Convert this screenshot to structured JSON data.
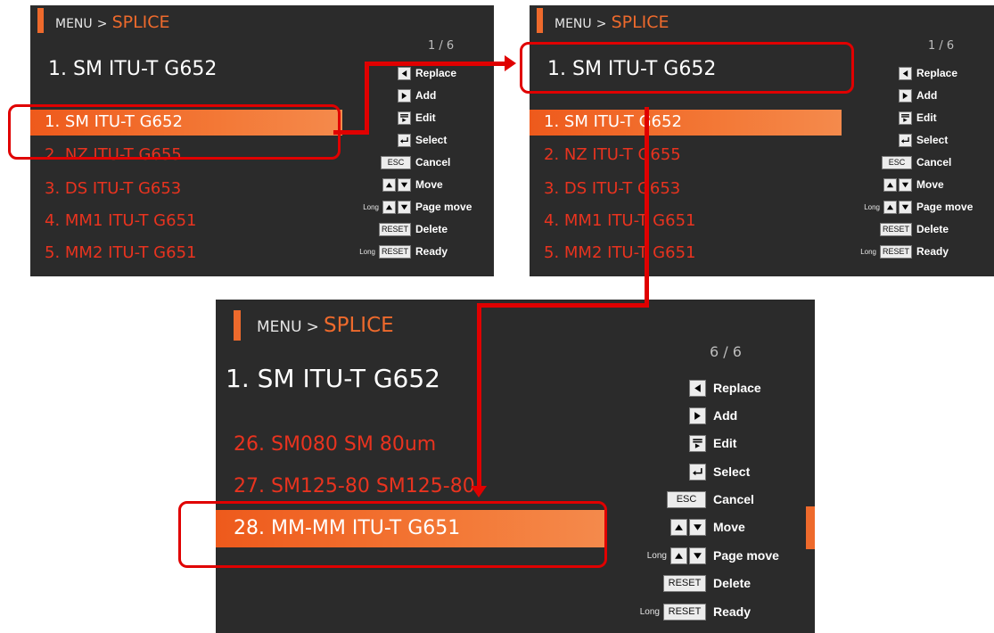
{
  "screen1": {
    "menu": "MENU",
    "sep": ">",
    "section": "SPLICE",
    "page": "1 / 6",
    "title": "1. SM ITU-T G652",
    "items": [
      "2. NZ ITU-T G655",
      "3. DS ITU-T G653",
      "4. MM1 ITU-T G651",
      "5. MM2 ITU-T G651"
    ],
    "selected": "1. SM ITU-T G652"
  },
  "screen2": {
    "menu": "MENU",
    "sep": ">",
    "section": "SPLICE",
    "page": "1 / 6",
    "title": "1. SM ITU-T G652",
    "items": [
      "2. NZ ITU-T G655",
      "3. DS ITU-T G653",
      "4. MM1 ITU-T G651",
      "5. MM2 ITU-T G651"
    ],
    "selected": "1. SM ITU-T G652"
  },
  "screen3": {
    "menu": "MENU",
    "sep": ">",
    "section": "SPLICE",
    "page": "6 / 6",
    "title": "1. SM ITU-T G652",
    "items": [
      "26. SM080 SM 80um",
      "27. SM125-80 SM125-80"
    ],
    "selected": "28. MM-MM ITU-T G651"
  },
  "help": {
    "long": "Long",
    "esc": "ESC",
    "reset": "RESET",
    "replace": "Replace",
    "add": "Add",
    "edit": "Edit",
    "select": "Select",
    "cancel": "Cancel",
    "move": "Move",
    "page_move": "Page move",
    "delete": "Delete",
    "ready": "Ready"
  },
  "colors": {
    "background": "#2b2b2b",
    "accent": "#ee6a2c",
    "list_text": "#e8331f",
    "annotation": "#e00000"
  },
  "icons": [
    "left-arrow-key-icon",
    "right-arrow-key-icon",
    "edit-key-icon",
    "enter-key-icon",
    "up-arrow-key-icon",
    "down-arrow-key-icon"
  ]
}
